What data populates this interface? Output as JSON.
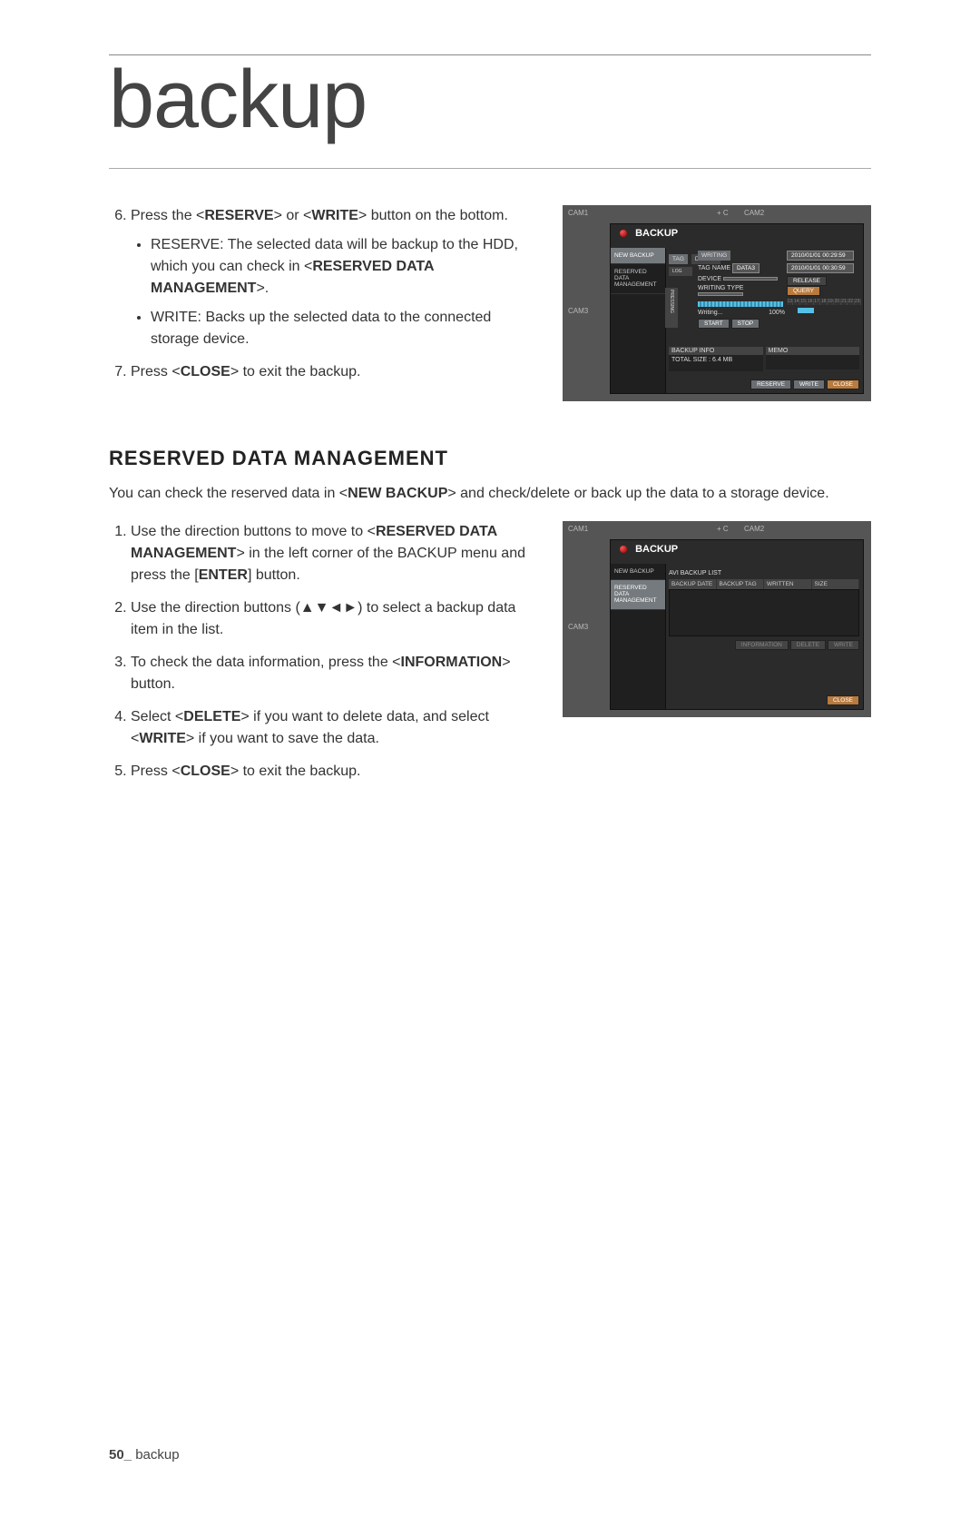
{
  "header": {
    "title": "backup"
  },
  "section1": {
    "step6": {
      "pre": "Press the <",
      "reserve": "RESERVE",
      "mid": "> or <",
      "write": "WRITE",
      "post": "> button on the bottom."
    },
    "bullet1": {
      "pre": "RESERVE: The selected data will be backup to the HDD, which you can check in <",
      "bold": "RESERVED DATA MANAGEMENT",
      "post": ">."
    },
    "bullet2": "WRITE: Backs up the selected data to the connected storage device.",
    "step7": {
      "pre": "Press <",
      "bold": "CLOSE",
      "post": "> to exit the backup."
    }
  },
  "section2": {
    "heading": "RESERVED DATA MANAGEMENT",
    "intro": {
      "pre": "You can check the reserved data in <",
      "bold": "NEW BACKUP",
      "post": "> and check/delete or back up the data to a storage device."
    },
    "step1": {
      "pre": "Use the direction buttons to move to <",
      "bold": "RESERVED DATA MANAGEMENT",
      "mid": "> in the left corner of the BACKUP menu and press the [",
      "bold2": "ENTER",
      "post": "] button."
    },
    "step2": "Use the direction buttons (▲▼◄►) to select a backup data item in the list.",
    "step3": {
      "pre": "To check the data information, press the <",
      "bold": "INFORMATION",
      "post": "> button."
    },
    "step4": {
      "pre": "Select <",
      "bold": "DELETE",
      "mid": "> if you want to delete data, and select <",
      "bold2": "WRITE",
      "post": "> if you want to save the data."
    },
    "step5": {
      "pre": "Press <",
      "bold": "CLOSE",
      "post": "> to exit the backup."
    }
  },
  "mock1": {
    "cam1": "CAM1",
    "cam2": "CAM2",
    "cam3": "CAM3",
    "c_label": "+ C",
    "panel_title": "BACKUP",
    "side_new": "NEW BACKUP",
    "side_reserved": "RESERVED DATA MANAGEMENT",
    "tab_tag": "TAG",
    "tab_device": "DEVICE",
    "tab_log": "LOG",
    "tab_pressing": "PRESSING",
    "writing_hdr": "WRITING",
    "tag_name_lbl": "TAG NAME",
    "tag_name_val": "DATA3",
    "device_lbl": "DEVICE",
    "writing_type_lbl": "WRITING TYPE",
    "dt1": "2010/01/01 00:29:59",
    "dt2": "2010/01/01 00:30:59",
    "release": "RELEASE",
    "query": "QUERY",
    "writing_txt": "Writing...",
    "percent": "100%",
    "btn_start": "START",
    "btn_stop": "STOP",
    "backup_info": "BACKUP INFO",
    "total_size": "TOTAL SIZE : 6.4 MB",
    "memo": "MEMO",
    "reserve": "RESERVE",
    "write": "WRITE",
    "close": "CLOSE"
  },
  "mock2": {
    "cam1": "CAM1",
    "cam2": "CAM2",
    "cam3": "CAM3",
    "c_label": "+ C",
    "panel_title": "BACKUP",
    "side_new": "NEW BACKUP",
    "side_reserved": "RESERVED DATA MANAGEMENT",
    "list_title": "AVI BACKUP LIST",
    "col_date": "BACKUP DATE",
    "col_tag": "BACKUP TAG",
    "col_written": "WRITTEN",
    "col_size": "SIZE",
    "btn_info": "INFORMATION",
    "btn_delete": "DELETE",
    "btn_write": "WRITE",
    "close": "CLOSE"
  },
  "footer": {
    "page": "50_",
    "label": "backup"
  }
}
